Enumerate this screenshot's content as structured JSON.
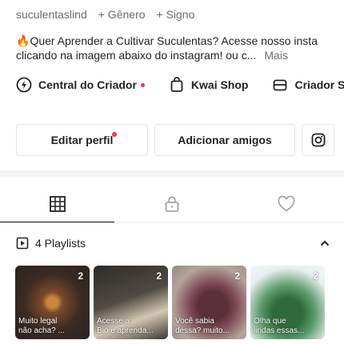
{
  "meta": {
    "username_cut": "suculentaslind",
    "gender_label": "+ Gênero",
    "sign_label": "+ Signo"
  },
  "bio": {
    "emoji": "🔥",
    "text": "Quer Aprender a Cultivar Suculentas? Acesse nosso insta clicando na imagem abaixo do instagram! ou c...",
    "more_label": "Mais"
  },
  "links": [
    {
      "icon": "creator-center-icon",
      "label": "Central do Criador"
    },
    {
      "icon": "shopping-bag-icon",
      "label": "Kwai Shop"
    },
    {
      "icon": "wallet-icon",
      "label": "Criador SI"
    }
  ],
  "buttons": {
    "edit_profile": "Editar perfil",
    "add_friends": "Adicionar amigos",
    "instagram_icon": "instagram-icon"
  },
  "tabs": [
    {
      "icon": "grid-icon",
      "active": true
    },
    {
      "icon": "lock-icon",
      "active": false
    },
    {
      "icon": "heart-icon",
      "active": false
    }
  ],
  "playlists": {
    "title": "4 Playlists",
    "items": [
      {
        "count": "2",
        "caption": "Muito legal\nnão acha? ..."
      },
      {
        "count": "2",
        "caption": "Acesse a\nBio e aprenda..."
      },
      {
        "count": "2",
        "caption": "Você sabia\ndessa? muito..."
      },
      {
        "count": "2",
        "caption": "Olha que\nlindas essas..."
      }
    ]
  },
  "colors": {
    "accent_red": "#fe2c55",
    "text_primary": "#222222",
    "text_secondary": "#6b6b6b"
  }
}
